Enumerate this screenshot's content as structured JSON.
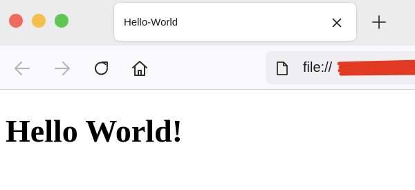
{
  "window": {
    "traffic_lights": {
      "close": "#ee6a5e",
      "minimize": "#f5bf4f",
      "maximize": "#61c554"
    }
  },
  "tabs": [
    {
      "title": "Hello-World",
      "close_icon": "close-icon",
      "active": true
    }
  ],
  "new_tab_icon": "plus-icon",
  "toolbar": {
    "icons": [
      "back-arrow-icon",
      "forward-arrow-icon",
      "reload-icon",
      "home-icon"
    ]
  },
  "address_bar": {
    "page_icon": "page-icon",
    "url_prefix": "file://",
    "url_redacted": true,
    "redaction_color": "#e23a22"
  },
  "page": {
    "heading": "Hello World!"
  }
}
